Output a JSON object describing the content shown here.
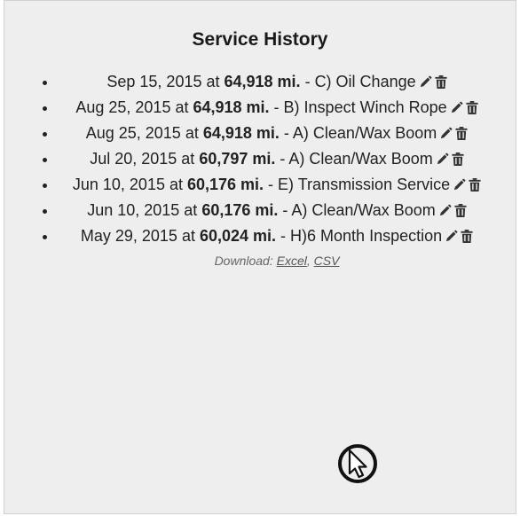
{
  "title": "Service History",
  "entries": [
    {
      "date": "Sep 15, 2015",
      "at": " at ",
      "miles": "64,918 mi.",
      "sep": " - ",
      "service": "C) Oil Change"
    },
    {
      "date": "Aug 25, 2015",
      "at": " at ",
      "miles": "64,918 mi.",
      "sep": " - ",
      "service": "B) Inspect Winch Rope"
    },
    {
      "date": "Aug 25, 2015",
      "at": " at ",
      "miles": "64,918 mi.",
      "sep": " - ",
      "service": "A) Clean/Wax Boom"
    },
    {
      "date": "Jul 20, 2015",
      "at": " at ",
      "miles": "60,797 mi.",
      "sep": " - ",
      "service": "A) Clean/Wax Boom"
    },
    {
      "date": "Jun 10, 2015",
      "at": " at ",
      "miles": "60,176 mi.",
      "sep": " - ",
      "service": "E) Transmission Service"
    },
    {
      "date": "Jun 10, 2015",
      "at": " at ",
      "miles": "60,176 mi.",
      "sep": " - ",
      "service": "A) Clean/Wax Boom"
    },
    {
      "date": "May 29, 2015",
      "at": " at ",
      "miles": "60,024 mi.",
      "sep": " - ",
      "service": "H)6 Month Inspection"
    }
  ],
  "icons": {
    "edit": "pencil-icon",
    "delete": "trash-icon"
  },
  "download": {
    "label": "Download: ",
    "excel": "Excel",
    "separator": ", ",
    "csv": "CSV"
  },
  "colors": {
    "panel_bg": "#eeeeee",
    "panel_border": "#d2d2d2",
    "text": "#222222",
    "icon": "#333333"
  }
}
